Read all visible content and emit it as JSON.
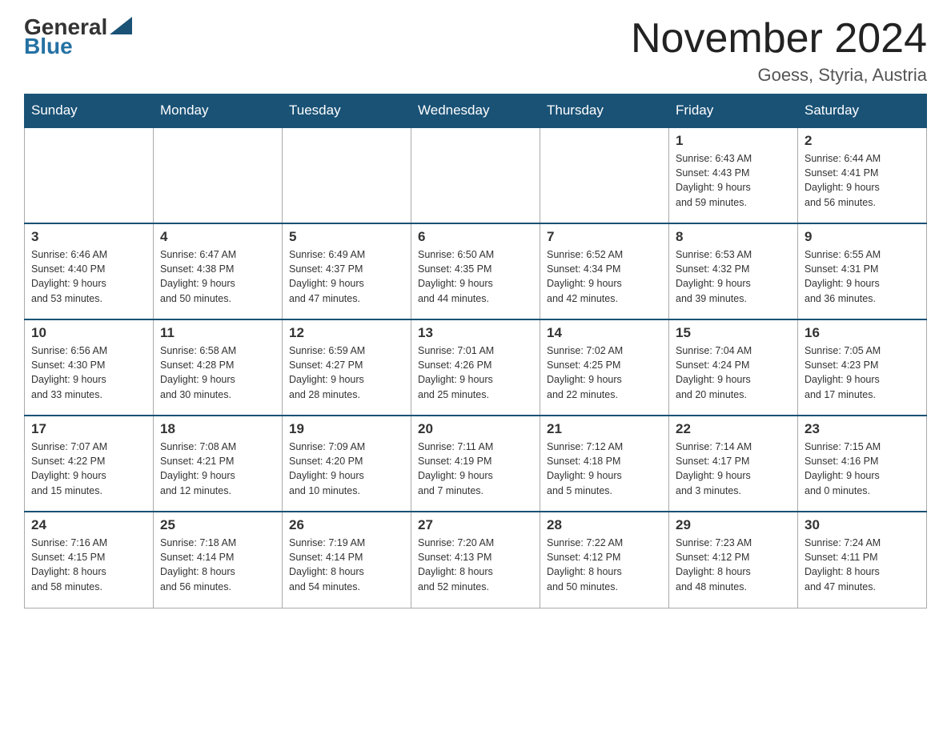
{
  "header": {
    "logo_general": "General",
    "logo_blue": "Blue",
    "month_title": "November 2024",
    "location": "Goess, Styria, Austria"
  },
  "weekdays": [
    "Sunday",
    "Monday",
    "Tuesday",
    "Wednesday",
    "Thursday",
    "Friday",
    "Saturday"
  ],
  "weeks": [
    [
      {
        "day": "",
        "info": ""
      },
      {
        "day": "",
        "info": ""
      },
      {
        "day": "",
        "info": ""
      },
      {
        "day": "",
        "info": ""
      },
      {
        "day": "",
        "info": ""
      },
      {
        "day": "1",
        "info": "Sunrise: 6:43 AM\nSunset: 4:43 PM\nDaylight: 9 hours\nand 59 minutes."
      },
      {
        "day": "2",
        "info": "Sunrise: 6:44 AM\nSunset: 4:41 PM\nDaylight: 9 hours\nand 56 minutes."
      }
    ],
    [
      {
        "day": "3",
        "info": "Sunrise: 6:46 AM\nSunset: 4:40 PM\nDaylight: 9 hours\nand 53 minutes."
      },
      {
        "day": "4",
        "info": "Sunrise: 6:47 AM\nSunset: 4:38 PM\nDaylight: 9 hours\nand 50 minutes."
      },
      {
        "day": "5",
        "info": "Sunrise: 6:49 AM\nSunset: 4:37 PM\nDaylight: 9 hours\nand 47 minutes."
      },
      {
        "day": "6",
        "info": "Sunrise: 6:50 AM\nSunset: 4:35 PM\nDaylight: 9 hours\nand 44 minutes."
      },
      {
        "day": "7",
        "info": "Sunrise: 6:52 AM\nSunset: 4:34 PM\nDaylight: 9 hours\nand 42 minutes."
      },
      {
        "day": "8",
        "info": "Sunrise: 6:53 AM\nSunset: 4:32 PM\nDaylight: 9 hours\nand 39 minutes."
      },
      {
        "day": "9",
        "info": "Sunrise: 6:55 AM\nSunset: 4:31 PM\nDaylight: 9 hours\nand 36 minutes."
      }
    ],
    [
      {
        "day": "10",
        "info": "Sunrise: 6:56 AM\nSunset: 4:30 PM\nDaylight: 9 hours\nand 33 minutes."
      },
      {
        "day": "11",
        "info": "Sunrise: 6:58 AM\nSunset: 4:28 PM\nDaylight: 9 hours\nand 30 minutes."
      },
      {
        "day": "12",
        "info": "Sunrise: 6:59 AM\nSunset: 4:27 PM\nDaylight: 9 hours\nand 28 minutes."
      },
      {
        "day": "13",
        "info": "Sunrise: 7:01 AM\nSunset: 4:26 PM\nDaylight: 9 hours\nand 25 minutes."
      },
      {
        "day": "14",
        "info": "Sunrise: 7:02 AM\nSunset: 4:25 PM\nDaylight: 9 hours\nand 22 minutes."
      },
      {
        "day": "15",
        "info": "Sunrise: 7:04 AM\nSunset: 4:24 PM\nDaylight: 9 hours\nand 20 minutes."
      },
      {
        "day": "16",
        "info": "Sunrise: 7:05 AM\nSunset: 4:23 PM\nDaylight: 9 hours\nand 17 minutes."
      }
    ],
    [
      {
        "day": "17",
        "info": "Sunrise: 7:07 AM\nSunset: 4:22 PM\nDaylight: 9 hours\nand 15 minutes."
      },
      {
        "day": "18",
        "info": "Sunrise: 7:08 AM\nSunset: 4:21 PM\nDaylight: 9 hours\nand 12 minutes."
      },
      {
        "day": "19",
        "info": "Sunrise: 7:09 AM\nSunset: 4:20 PM\nDaylight: 9 hours\nand 10 minutes."
      },
      {
        "day": "20",
        "info": "Sunrise: 7:11 AM\nSunset: 4:19 PM\nDaylight: 9 hours\nand 7 minutes."
      },
      {
        "day": "21",
        "info": "Sunrise: 7:12 AM\nSunset: 4:18 PM\nDaylight: 9 hours\nand 5 minutes."
      },
      {
        "day": "22",
        "info": "Sunrise: 7:14 AM\nSunset: 4:17 PM\nDaylight: 9 hours\nand 3 minutes."
      },
      {
        "day": "23",
        "info": "Sunrise: 7:15 AM\nSunset: 4:16 PM\nDaylight: 9 hours\nand 0 minutes."
      }
    ],
    [
      {
        "day": "24",
        "info": "Sunrise: 7:16 AM\nSunset: 4:15 PM\nDaylight: 8 hours\nand 58 minutes."
      },
      {
        "day": "25",
        "info": "Sunrise: 7:18 AM\nSunset: 4:14 PM\nDaylight: 8 hours\nand 56 minutes."
      },
      {
        "day": "26",
        "info": "Sunrise: 7:19 AM\nSunset: 4:14 PM\nDaylight: 8 hours\nand 54 minutes."
      },
      {
        "day": "27",
        "info": "Sunrise: 7:20 AM\nSunset: 4:13 PM\nDaylight: 8 hours\nand 52 minutes."
      },
      {
        "day": "28",
        "info": "Sunrise: 7:22 AM\nSunset: 4:12 PM\nDaylight: 8 hours\nand 50 minutes."
      },
      {
        "day": "29",
        "info": "Sunrise: 7:23 AM\nSunset: 4:12 PM\nDaylight: 8 hours\nand 48 minutes."
      },
      {
        "day": "30",
        "info": "Sunrise: 7:24 AM\nSunset: 4:11 PM\nDaylight: 8 hours\nand 47 minutes."
      }
    ]
  ]
}
